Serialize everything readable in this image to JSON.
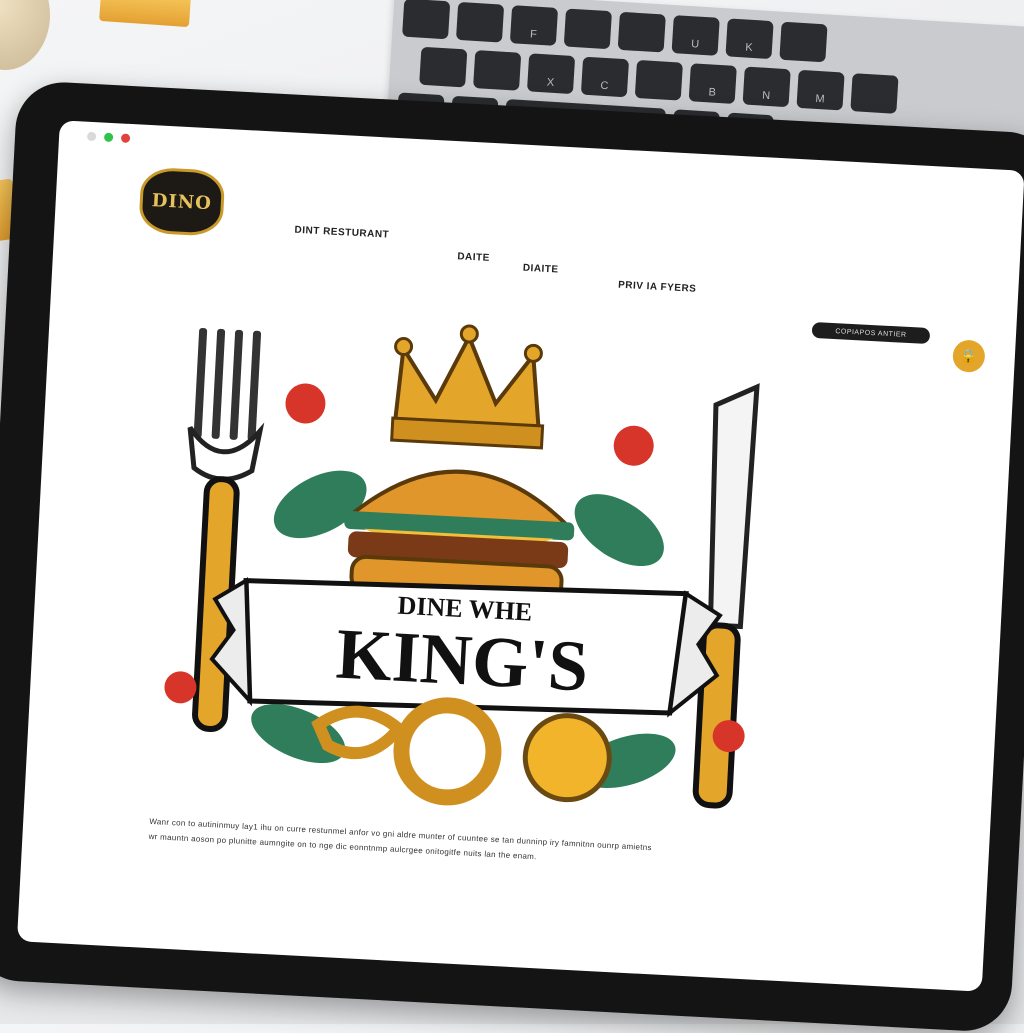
{
  "browser": {
    "dot_colors": [
      "#d9d9d9",
      "#2ec44a",
      "#e0423c"
    ]
  },
  "logo": {
    "text": "DINO"
  },
  "nav": {
    "items": [
      {
        "label": "DINT RESTURANT"
      },
      {
        "label": "DAITE"
      },
      {
        "label": "DIAITE"
      },
      {
        "label": "PRIV IA FYERS"
      }
    ]
  },
  "cta": {
    "label": "COPIAPOS ANTIER"
  },
  "bag_icon": "shopping-bag-icon",
  "hero": {
    "tagline": "DINE WHE",
    "title": "KING'S",
    "accent": "#e4a62a",
    "leaf": "#2f7d5a"
  },
  "description": {
    "lines": [
      "Wanr con to autininmuy lay1 ihu on curre restunmel anfor vo gni aldre munter of cuuntee se tan dunninp iry famnitnn ounrp amietns",
      "wr mauntn aoson po plunitte aumngite on to nge dic eonntnmp aulcrgee onitogitfe nuits lan the enam."
    ]
  },
  "keyboard": {
    "rows": [
      [
        "",
        "",
        "F",
        "",
        "",
        "U",
        "K",
        ""
      ],
      [
        "",
        "",
        "X",
        "C",
        "",
        "B",
        "N",
        "M",
        ""
      ],
      [
        "",
        "",
        "",
        "",
        ""
      ]
    ]
  }
}
